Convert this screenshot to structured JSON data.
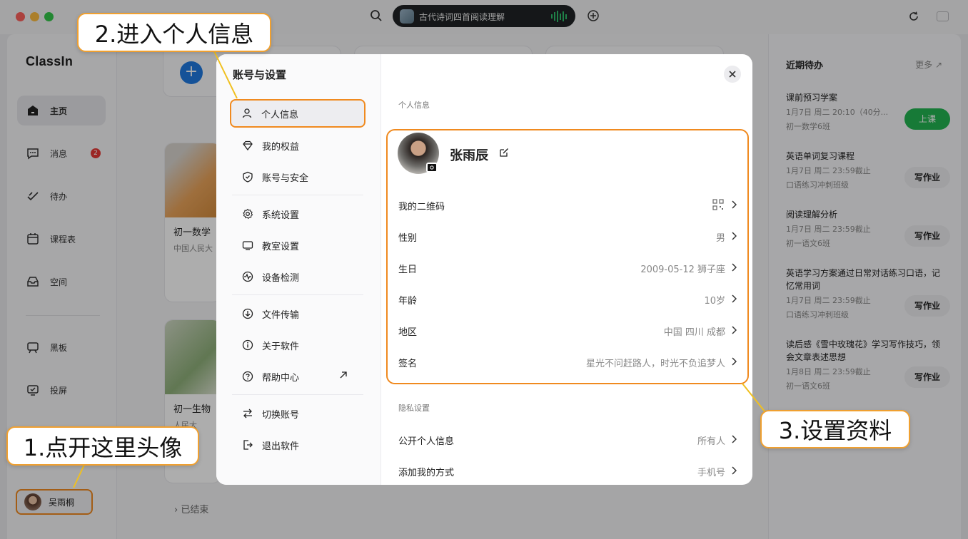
{
  "titlebar": {
    "now_playing": "古代诗词四首阅读理解"
  },
  "sidebar": {
    "logo": "ClassIn",
    "items": [
      {
        "label": "主页",
        "icon": "home-icon"
      },
      {
        "label": "消息",
        "icon": "message-icon",
        "badge": "2"
      },
      {
        "label": "待办",
        "icon": "todo-icon"
      },
      {
        "label": "课程表",
        "icon": "calendar-icon"
      },
      {
        "label": "空间",
        "icon": "space-icon"
      },
      {
        "label": "黑板",
        "icon": "blackboard-icon"
      },
      {
        "label": "投屏",
        "icon": "screencast-icon"
      }
    ],
    "user_name": "吴雨桐"
  },
  "courses": [
    {
      "name": "初一数学",
      "sub": "中国人民大"
    },
    {
      "name": "初一生物",
      "sub": "人民大"
    }
  ],
  "ended_label": "已结束",
  "right_panel": {
    "title": "近期待办",
    "more": "更多",
    "todos": [
      {
        "title": "课前预习学案",
        "time": "1月7日 周二 20:10（40分...",
        "class": "初一数学6班",
        "button": "上课"
      },
      {
        "title": "英语单词复习课程",
        "time": "1月7日 周二 23:59截止",
        "class": "口语练习冲刺班级",
        "button": "写作业"
      },
      {
        "title": "阅读理解分析",
        "time": "1月7日 周二 23:59截止",
        "class": "初一语文6班",
        "button": "写作业"
      },
      {
        "title": "英语学习方案通过日常对话练习口语，记忆常用词",
        "time": "1月7日 周二 23:59截止",
        "class": "口语练习冲刺班级",
        "button": "写作业"
      },
      {
        "title": "读后感《雪中玫瑰花》学习写作技巧，领会文章表述思想",
        "time": "1月8日 周二 23:59截止",
        "class": "初一语文6班",
        "button": "写作业"
      }
    ]
  },
  "modal": {
    "title": "账号与设置",
    "menu": [
      {
        "label": "个人信息",
        "icon": "person-icon"
      },
      {
        "label": "我的权益",
        "icon": "diamond-icon"
      },
      {
        "label": "账号与安全",
        "icon": "shield-icon"
      },
      {
        "label": "系统设置",
        "icon": "gear-icon"
      },
      {
        "label": "教室设置",
        "icon": "screen-icon"
      },
      {
        "label": "设备检测",
        "icon": "pulse-icon"
      },
      {
        "label": "文件传输",
        "icon": "download-icon"
      },
      {
        "label": "关于软件",
        "icon": "info-icon"
      },
      {
        "label": "帮助中心",
        "icon": "help-icon"
      },
      {
        "label": "切换账号",
        "icon": "switch-icon"
      },
      {
        "label": "退出软件",
        "icon": "logout-icon"
      }
    ],
    "section_personal": "个人信息",
    "profile_name": "张雨辰",
    "rows": [
      {
        "key": "我的二维码",
        "value": ""
      },
      {
        "key": "性别",
        "value": "男"
      },
      {
        "key": "生日",
        "value": "2009-05-12 狮子座"
      },
      {
        "key": "年龄",
        "value": "10岁"
      },
      {
        "key": "地区",
        "value": "中国 四川 成都"
      },
      {
        "key": "签名",
        "value": "星光不问赶路人，时光不负追梦人"
      }
    ],
    "section_privacy": "隐私设置",
    "privacy_rows": [
      {
        "key": "公开个人信息",
        "value": "所有人"
      },
      {
        "key": "添加我的方式",
        "value": "手机号"
      }
    ]
  },
  "callouts": {
    "step1": "1.点开这里头像",
    "step2": "2.进入个人信息",
    "step3": "3.设置资料"
  },
  "colors": {
    "accent": "#f08a1f",
    "primary": "#1f7ae0",
    "green": "#23b452"
  }
}
